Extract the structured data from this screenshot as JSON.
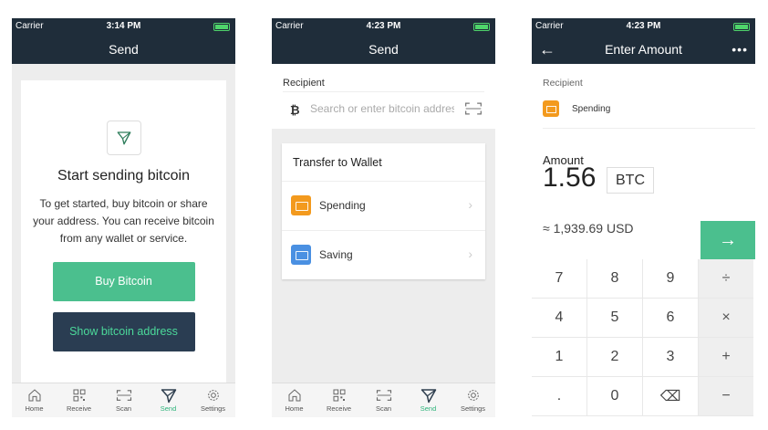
{
  "status": {
    "carrier": "Carrier",
    "times": [
      "3:14 PM",
      "4:23 PM",
      "4:23 PM"
    ]
  },
  "screen1": {
    "title": "Send",
    "heading": "Start sending bitcoin",
    "body": "To get started, buy bitcoin or share your address. You can receive bitcoin from any wallet or service.",
    "buy_button": "Buy Bitcoin",
    "show_address_button": "Show bitcoin address"
  },
  "screen2": {
    "title": "Send",
    "recipient_label": "Recipient",
    "search_placeholder": "Search or enter bitcoin address",
    "btc_symbol": "₿",
    "card_title": "Transfer to Wallet",
    "wallets": [
      {
        "label": "Spending",
        "color": "#f39a1e"
      },
      {
        "label": "Saving",
        "color": "#4a90e2"
      }
    ]
  },
  "screen3": {
    "title": "Enter Amount",
    "back": "←",
    "more": "•••",
    "recipient_label": "Recipient",
    "recipient_wallet": "Spending",
    "amount_label": "Amount",
    "amount_value": "1.56",
    "unit": "BTC",
    "fiat_value": "≈ 1,939.69 USD",
    "go": "→",
    "keys": [
      "7",
      "8",
      "9",
      "÷",
      "4",
      "5",
      "6",
      "×",
      "1",
      "2",
      "3",
      "+",
      ".",
      "0",
      "⌫",
      "−"
    ]
  },
  "tabs": [
    "Home",
    "Receive",
    "Scan",
    "Send",
    "Settings"
  ],
  "colors": {
    "navbar": "#1f2d3a",
    "accent_green": "#4bbf8e",
    "dark_button": "#2a3d52",
    "active_tab": "#2db37a"
  }
}
